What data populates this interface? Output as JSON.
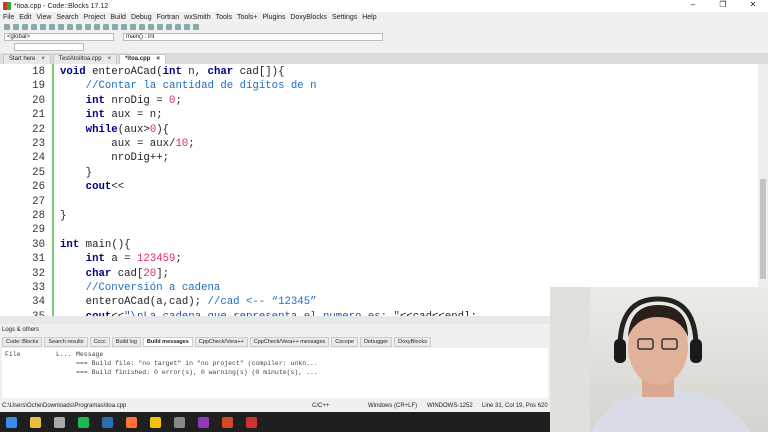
{
  "window": {
    "title": "*itoa.cpp - Code::Blocks 17.12",
    "min": "–",
    "max": "❐",
    "close": "✕"
  },
  "menu": [
    "File",
    "Edit",
    "View",
    "Search",
    "Project",
    "Build",
    "Debug",
    "Fortran",
    "wxSmith",
    "Tools",
    "Tools+",
    "Plugins",
    "DoxyBlocks",
    "Settings",
    "Help"
  ],
  "toolbar": {
    "scope": "<global>",
    "function": "main() : int"
  },
  "tabs": [
    {
      "label": "Start here",
      "close": "×"
    },
    {
      "label": "TestAtoiItoa.cpp",
      "close": "×"
    },
    {
      "label": "*itoa.cpp",
      "close": "×"
    }
  ],
  "editor": {
    "lines": [
      {
        "n": "18",
        "html": "<span class='kw'>void</span> enteroACad(<span class='kw'>int</span> n, <span class='kw'>char</span> cad[]){"
      },
      {
        "n": "19",
        "html": "    <span class='cm'>//Contar la cantidad de dígitos de n</span>"
      },
      {
        "n": "20",
        "html": "    <span class='kw'>int</span> nroDig = <span class='num'>0</span>;"
      },
      {
        "n": "21",
        "html": "    <span class='kw'>int</span> aux = n;"
      },
      {
        "n": "22",
        "html": "    <span class='kw'>while</span>(aux&gt;<span class='num'>0</span>){"
      },
      {
        "n": "23",
        "html": "        aux = aux/<span class='num'>10</span>;"
      },
      {
        "n": "24",
        "html": "        nroDig++;"
      },
      {
        "n": "25",
        "html": "    }"
      },
      {
        "n": "26",
        "html": "    <span class='kw'>cout</span>&lt;&lt;"
      },
      {
        "n": "27",
        "html": ""
      },
      {
        "n": "28",
        "html": "}"
      },
      {
        "n": "29",
        "html": ""
      },
      {
        "n": "30",
        "html": "<span class='kw'>int</span> main(){"
      },
      {
        "n": "31",
        "html": "    <span class='kw'>int</span> a = <span class='num'>123459</span>;"
      },
      {
        "n": "32",
        "html": "    <span class='kw'>char</span> cad[<span class='num'>20</span>];"
      },
      {
        "n": "33",
        "html": "    <span class='cm'>//Conversión a cadena</span>"
      },
      {
        "n": "34",
        "html": "    enteroACad(a,cad); <span class='cm'>//cad &lt;-- “12345”</span>"
      },
      {
        "n": "35",
        "html": "    <span class='kw'>cout</span>&lt;&lt;<span class='str'>\"\\nLa cadena que representa el numero es: \"</span>&lt;&lt;cad&lt;&lt;endl;"
      }
    ]
  },
  "logs": {
    "title": "Logs & others",
    "tabs": [
      "Code::Blocks",
      "Search results",
      "Cccc",
      "Build log",
      "Build messages",
      "CppCheck/Vera++",
      "CppCheck/Vera++ messages",
      "Cscope",
      "Debugger",
      "DoxyBlocks"
    ],
    "active": "Build messages",
    "headers": {
      "file": "File",
      "line": "L...",
      "message": "Message"
    },
    "messages": [
      "=== Build file: \"no target\" in \"no project\" (compiler: unkn...",
      "=== Build finished: 0 error(s), 0 warning(s) (0 minute(s), ..."
    ]
  },
  "status": {
    "path": "C:\\Users\\Oche\\Downloads\\Programas\\itoa.cpp",
    "lang": "C/C++",
    "eol": "Windows (CR+LF)",
    "encoding": "WINDOWS-1252",
    "position": "Line 31, Col 19, Pos 620"
  },
  "taskbar": {
    "icons": [
      "windows-start",
      "file-explorer",
      "printer",
      "spotify",
      "steam",
      "firefox",
      "chrome",
      "obs",
      "onenote",
      "powerpoint",
      "codeblocks"
    ],
    "colors": [
      "#3a8ee6",
      "#e8c040",
      "#aaa",
      "#1db954",
      "#2a6fb0",
      "#ff7139",
      "#f4c20d",
      "#888",
      "#8e3bb9",
      "#d24726",
      "#c33"
    ]
  }
}
